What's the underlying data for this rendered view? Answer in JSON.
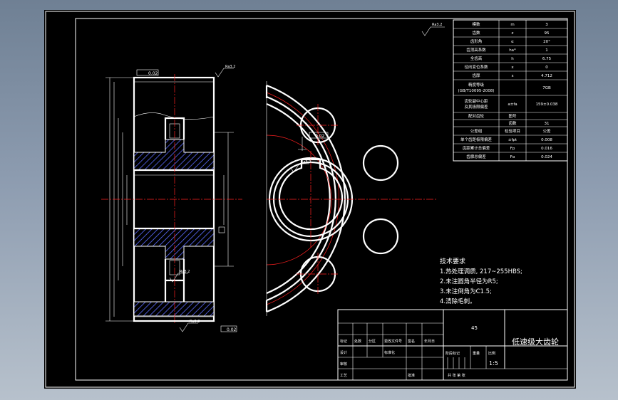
{
  "drawing": {
    "title": "低速级大齿轮",
    "scale": "1:5",
    "roughness_mark": "Ra3.2",
    "tolerance_labels": {
      "top_frame": "0.02",
      "bottom_frame": "0.02",
      "mid_frame": "0.02"
    },
    "params_table": {
      "rows": [
        {
          "name": "模数",
          "symbol": "m",
          "value": "3"
        },
        {
          "name": "齿数",
          "symbol": "z",
          "value": "95"
        },
        {
          "name": "齿形角",
          "symbol": "α",
          "value": "20°"
        },
        {
          "name": "齿顶高系数",
          "symbol": "ha*",
          "value": "1"
        },
        {
          "name": "全齿高",
          "symbol": "h",
          "value": "6.75"
        },
        {
          "name": "径向变位系数",
          "symbol": "x",
          "value": "0"
        },
        {
          "name": "齿厚",
          "symbol": "s",
          "value": "4.712"
        },
        {
          "name": "精度等级\n(GB/T10095-2008)",
          "symbol": "",
          "value": "7GB"
        },
        {
          "name": "齿轮副中心距\n及其极限偏差",
          "symbol": "a±fa",
          "value": "159±0.038"
        },
        {
          "name": "配对齿轮",
          "symbol": "图号",
          "value": ""
        },
        {
          "name": "",
          "symbol": "齿数",
          "value": "31"
        },
        {
          "name": "公差组",
          "symbol": "检验项目",
          "value": "公差"
        },
        {
          "name": "单个齿距极限偏差",
          "symbol": "±fpt",
          "value": "0.008"
        },
        {
          "name": "齿距累计总偏差",
          "symbol": "Fp",
          "value": "0.016"
        },
        {
          "name": "齿廓总偏差",
          "symbol": "Fα",
          "value": "0.024"
        }
      ]
    },
    "tech_requirements": {
      "heading": "技术要求",
      "items": [
        "1.热处理调质, 217~255HBS;",
        "2.未注圆角半径为R5;",
        "3.未注倒角为C1.5;",
        "4.清除毛刺。"
      ]
    },
    "title_block": {
      "material": "45",
      "labels": {
        "mark": "标记",
        "count": "处数",
        "zone": "分区",
        "doc_no": "更改文件号",
        "sign": "签名",
        "date": "年月日",
        "design": "设计",
        "std": "标准化",
        "stage_mark": "阶段标记",
        "weight": "重量",
        "ratio": "比例",
        "review": "审核",
        "process": "工艺",
        "approve": "批准",
        "sheet": "共 张 第 张"
      }
    }
  }
}
